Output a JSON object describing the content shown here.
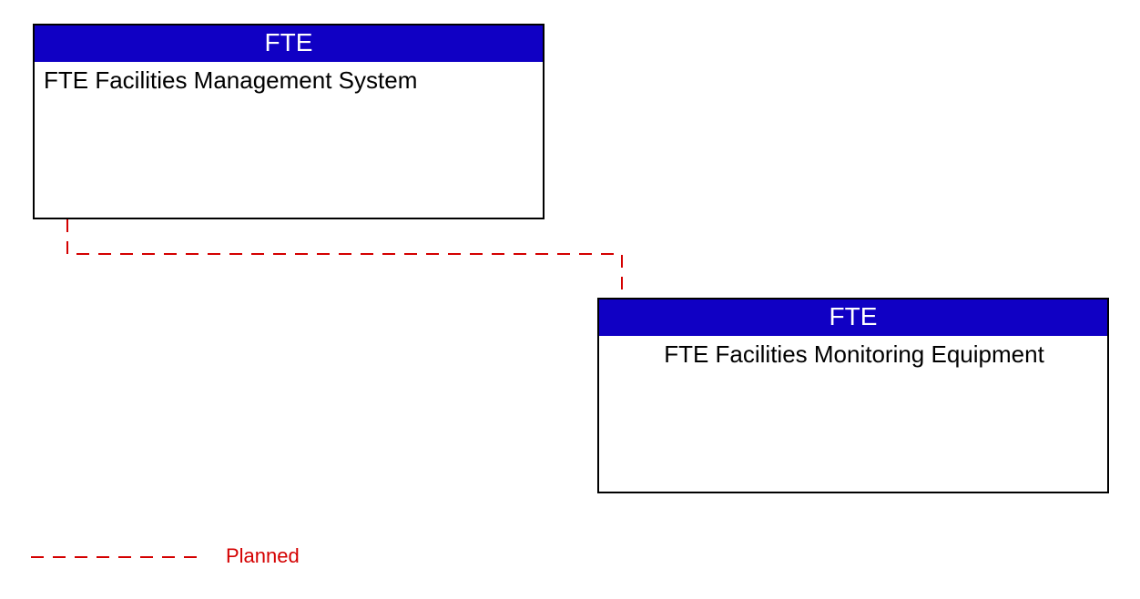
{
  "nodes": {
    "mgmt": {
      "header": "FTE",
      "body": "FTE Facilities Management System"
    },
    "monitor": {
      "header": "FTE",
      "body": "FTE Facilities Monitoring Equipment"
    }
  },
  "legend": {
    "planned": "Planned"
  },
  "colors": {
    "header_bg": "#1000c4",
    "header_fg": "#ffffff",
    "border": "#000000",
    "planned_line": "#d40000"
  },
  "connections": {
    "mgmt_to_monitor": {
      "type": "planned",
      "style": "dashed"
    }
  }
}
